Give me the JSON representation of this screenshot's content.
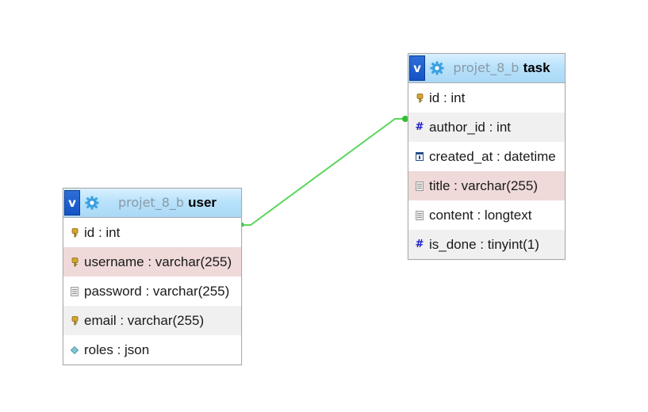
{
  "tables": {
    "user": {
      "database": "projet_8_b",
      "name": "user",
      "toggle": "v",
      "columns": [
        {
          "text": "id : int",
          "icon": "key-icon",
          "style": "plain"
        },
        {
          "text": "username : varchar(255)",
          "icon": "key-icon",
          "style": "highlight"
        },
        {
          "text": "password : varchar(255)",
          "icon": "text-field-icon",
          "style": "plain"
        },
        {
          "text": "email : varchar(255)",
          "icon": "key-icon",
          "style": "alt"
        },
        {
          "text": "roles : json",
          "icon": "diamond-icon",
          "style": "plain"
        }
      ]
    },
    "task": {
      "database": "projet_8_b",
      "name": "task",
      "toggle": "v",
      "columns": [
        {
          "text": "id : int",
          "icon": "key-icon",
          "style": "plain"
        },
        {
          "text": "author_id : int",
          "icon": "hash-icon",
          "style": "alt"
        },
        {
          "text": "created_at : datetime",
          "icon": "calendar-icon",
          "style": "plain"
        },
        {
          "text": "title : varchar(255)",
          "icon": "text-field-icon",
          "style": "highlight"
        },
        {
          "text": "content : longtext",
          "icon": "text-field-icon",
          "style": "plain"
        },
        {
          "text": "is_done : tinyint(1)",
          "icon": "hash-icon",
          "style": "alt"
        }
      ]
    }
  },
  "colors": {
    "relation_line": "#5cd65c",
    "header_gradient_top": "#d8f0ff",
    "header_gradient_bottom": "#a9d8f6",
    "toggle_blue": "#1553c6",
    "gear_blue": "#3b9fe0",
    "row_highlight": "#efd9d9",
    "row_alt": "#f0f0f0"
  },
  "relation": {
    "from": "task.author_id",
    "to": "user.id"
  }
}
